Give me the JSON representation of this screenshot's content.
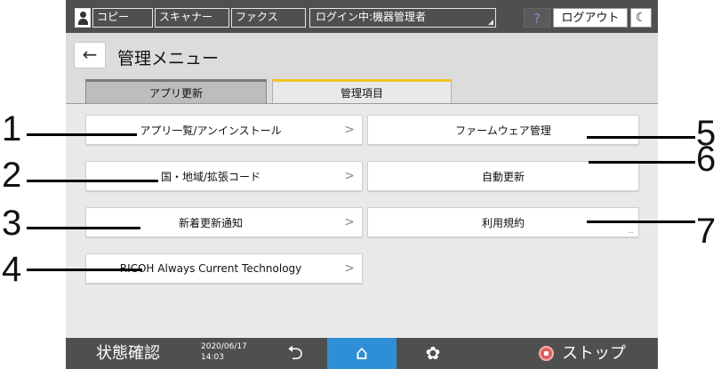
{
  "topbar": {
    "tabs": [
      {
        "label": "コピー"
      },
      {
        "label": "スキャナー"
      },
      {
        "label": "ファクス"
      }
    ],
    "login_status": "ログイン中:機器管理者",
    "help_label": "?",
    "logout_label": "ログアウト",
    "moon_label": "☾"
  },
  "header": {
    "back_label": "←",
    "title": "管理メニュー"
  },
  "tabs": {
    "apps_update": "アプリ更新",
    "admin_items": "管理項目"
  },
  "menu": {
    "left": [
      {
        "label": "アプリ一覧/アンインストール"
      },
      {
        "label": "国・地域/拡張コード"
      },
      {
        "label": "新着更新通知"
      },
      {
        "label": "RICOH Always Current Technology"
      }
    ],
    "right": [
      {
        "label": "ファームウェア管理"
      },
      {
        "label": "自動更新"
      },
      {
        "label": "利用規約"
      }
    ],
    "chevron": ">",
    "more": "..."
  },
  "callouts": [
    "1",
    "2",
    "3",
    "4",
    "5",
    "6",
    "7"
  ],
  "bottombar": {
    "status_label": "状態確認",
    "date": "2020/06/17",
    "time": "14:03",
    "back_icon": "⮌",
    "home_icon": "⌂",
    "gear_icon": "✿",
    "stop_label": "ストップ"
  },
  "colors": {
    "bar": "#4f4f4f",
    "accent_tab": "#f0c228",
    "home_button": "#2f8fd6",
    "stop_icon": "#e06060"
  }
}
